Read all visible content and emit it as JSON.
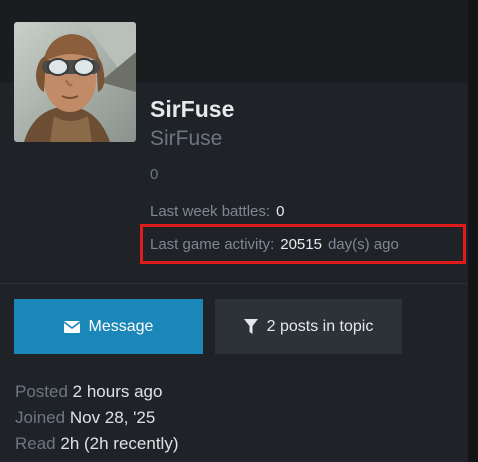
{
  "profile": {
    "username": "SirFuse",
    "display_name": "SirFuse",
    "count": "0",
    "stats": {
      "battles_label": "Last week battles",
      "battles_value": "0",
      "activity_label": "Last game activity",
      "activity_value": "20515",
      "activity_suffix": "day(s) ago"
    }
  },
  "actions": {
    "message_label": "Message",
    "posts_label": "2 posts in topic",
    "message_icon": "envelope-icon",
    "posts_icon": "filter-icon"
  },
  "meta": {
    "posted_label": "Posted",
    "posted_value": "2 hours ago",
    "joined_label": "Joined",
    "joined_value": "Nov 28, '25",
    "read_label": "Read",
    "read_value": "2h (2h recently)"
  },
  "colors": {
    "accent": "#1b86b8",
    "highlight": "#e01b1b"
  }
}
